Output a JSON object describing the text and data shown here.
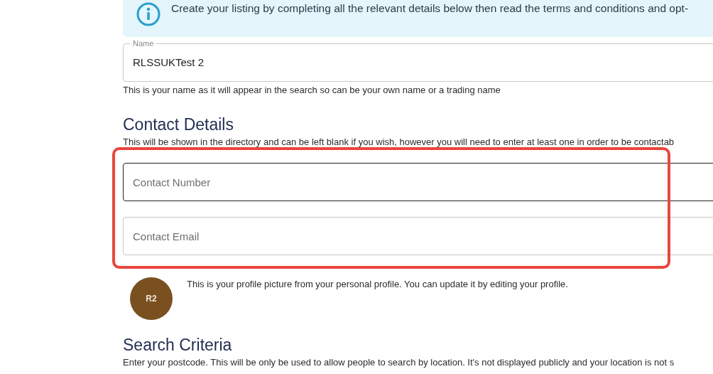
{
  "info_banner": {
    "text": "Create your listing by completing all the relevant details below then read the terms and conditions and opt-"
  },
  "name_field": {
    "label": "Name",
    "value": "RLSSUKTest 2",
    "help": "This is your name as it will appear in the search so can be your own name or a trading name"
  },
  "contact_details": {
    "heading": "Contact Details",
    "description": "This will be shown in the directory and can be left blank if you wish, however you will need to enter at least one in order to be contactab",
    "fields": [
      {
        "placeholder": "Contact Number",
        "focused": true
      },
      {
        "placeholder": "Contact Email",
        "focused": false
      }
    ]
  },
  "profile": {
    "initials": "R2",
    "text": "This is your profile picture from your personal profile. You can update it by editing your profile."
  },
  "search_criteria": {
    "heading": "Search Criteria",
    "description": "Enter your postcode. This will be only be used to allow people to search by location. It's not displayed publicly and your location is not s"
  }
}
